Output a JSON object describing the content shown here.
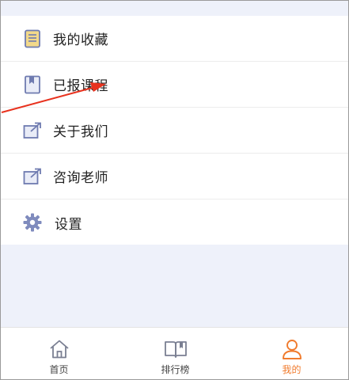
{
  "menu": {
    "items": [
      {
        "label": "我的收藏",
        "icon": "notebook-icon"
      },
      {
        "label": "已报课程",
        "icon": "book-icon"
      },
      {
        "label": "关于我们",
        "icon": "external-link-icon"
      },
      {
        "label": "咨询老师",
        "icon": "external-link-icon"
      },
      {
        "label": "设置",
        "icon": "gear-icon"
      }
    ]
  },
  "tabbar": {
    "tabs": [
      {
        "label": "首页",
        "icon": "home-icon",
        "active": false
      },
      {
        "label": "排行榜",
        "icon": "open-book-icon",
        "active": false
      },
      {
        "label": "我的",
        "icon": "user-icon",
        "active": true
      }
    ]
  },
  "colors": {
    "accent": "#f07b2d",
    "annotation": "#e8321e",
    "icon_blue": "#6f7bb0",
    "icon_yellow": "#f2d98a",
    "background": "#eef1fa"
  }
}
